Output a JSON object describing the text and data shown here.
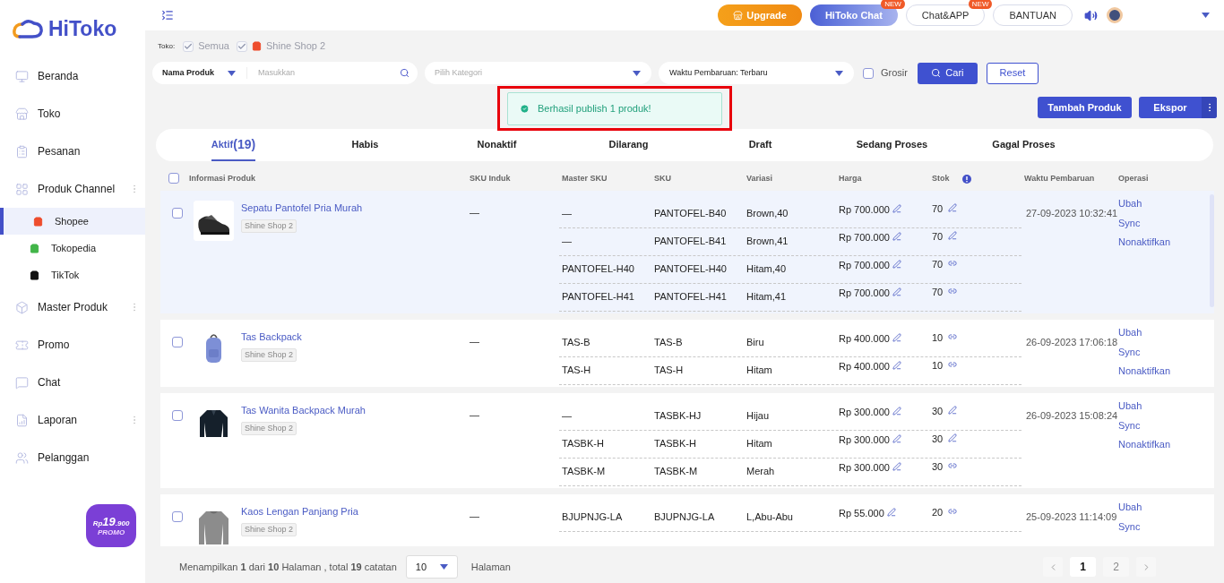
{
  "sidebar": {
    "logo": "HiToko",
    "items": [
      {
        "label": "Beranda",
        "has_menu": false
      },
      {
        "label": "Toko",
        "has_menu": false
      },
      {
        "label": "Pesanan",
        "has_menu": false
      },
      {
        "label": "Produk Channel",
        "has_menu": true,
        "children": [
          {
            "label": "Shopee",
            "selected": true
          },
          {
            "label": "Tokopedia",
            "selected": false
          },
          {
            "label": "TikTok",
            "selected": false
          }
        ]
      },
      {
        "label": "Master Produk",
        "has_menu": true
      },
      {
        "label": "Promo",
        "has_menu": false
      },
      {
        "label": "Chat",
        "has_menu": false
      },
      {
        "label": "Laporan",
        "has_menu": true
      },
      {
        "label": "Pelanggan",
        "has_menu": false
      }
    ],
    "promo": {
      "currency": "Rp",
      "amount": "19",
      "decimals": ".900",
      "label": "PROMO"
    }
  },
  "topbar": {
    "buttons": [
      {
        "label": "Upgrade",
        "kind": "upgrade"
      },
      {
        "label": "HiToko Chat",
        "kind": "chat",
        "badge": "NEW"
      },
      {
        "label": "Chat&APP",
        "kind": "outline",
        "badge": "NEW"
      },
      {
        "label": "BANTUAN",
        "kind": "outline"
      }
    ]
  },
  "filters": {
    "store_label": "Toko:",
    "stores": [
      {
        "label": "Semua",
        "kind": "all",
        "checked": true,
        "disabled": true
      },
      {
        "label": "Shine Shop 2",
        "kind": "shop",
        "checked": true,
        "disabled": true
      }
    ],
    "search_by": "Nama Produk",
    "search_placeholder": "Masukkan",
    "category_placeholder": "Pilih Kategori",
    "sort": "Waktu Pembaruan: Terbaru",
    "wholesale": {
      "label": "Grosir",
      "checked": false
    },
    "search_button": "Cari",
    "reset_button": "Reset"
  },
  "toast": {
    "message": "Berhasil publish 1 produk!",
    "highlighted": true
  },
  "actions": {
    "add": "Tambah Produk",
    "export": "Ekspor"
  },
  "tabs": [
    {
      "label": "Aktif",
      "count": "(19)",
      "selected": true
    },
    {
      "label": "Habis",
      "selected": false
    },
    {
      "label": "Nonaktif",
      "selected": false
    },
    {
      "label": "Dilarang",
      "selected": false
    },
    {
      "label": "Draft",
      "selected": false
    },
    {
      "label": "Sedang Proses",
      "selected": false
    },
    {
      "label": "Gagal Proses",
      "selected": false
    }
  ],
  "table": {
    "select_all": {
      "checked": false
    },
    "columns": [
      {
        "label": "Informasi Produk",
        "info": false
      },
      {
        "label": "SKU Induk",
        "info": false
      },
      {
        "label": "Master SKU",
        "info": false
      },
      {
        "label": "SKU",
        "info": false
      },
      {
        "label": "Variasi",
        "info": false
      },
      {
        "label": "Harga",
        "info": false
      },
      {
        "label": "Stok",
        "info": true
      },
      {
        "label": "Waktu Pembaruan",
        "info": false
      },
      {
        "label": "Operasi",
        "info": false
      }
    ],
    "products": [
      {
        "name": "Sepatu Pantofel Pria Murah",
        "store": "Shine Shop 2",
        "checked": false,
        "highlighted": true,
        "sku_induk": "—",
        "updated": "27-09-2023 10:32:41",
        "operations": [
          "Ubah",
          "Sync",
          "Nonaktifkan"
        ],
        "variants": [
          {
            "master_sku": "—",
            "sku": "PANTOFEL-B40",
            "variasi": "Brown,40",
            "harga": "Rp 700.000",
            "stok": "70",
            "stock_linked": false
          },
          {
            "master_sku": "—",
            "sku": "PANTOFEL-B41",
            "variasi": "Brown,41",
            "harga": "Rp 700.000",
            "stok": "70",
            "stock_linked": false
          },
          {
            "master_sku": "PANTOFEL-H40",
            "sku": "PANTOFEL-H40",
            "variasi": "Hitam,40",
            "harga": "Rp 700.000",
            "stok": "70",
            "stock_linked": true
          },
          {
            "master_sku": "PANTOFEL-H41",
            "sku": "PANTOFEL-H41",
            "variasi": "Hitam,41",
            "harga": "Rp 700.000",
            "stok": "70",
            "stock_linked": true
          }
        ]
      },
      {
        "name": "Tas Backpack",
        "store": "Shine Shop 2",
        "checked": false,
        "highlighted": false,
        "sku_induk": "—",
        "updated": "26-09-2023 17:06:18",
        "operations": [
          "Ubah",
          "Sync",
          "Nonaktifkan"
        ],
        "variants": [
          {
            "master_sku": "TAS-B",
            "sku": "TAS-B",
            "variasi": "Biru",
            "harga": "Rp 400.000",
            "stok": "10",
            "stock_linked": true
          },
          {
            "master_sku": "TAS-H",
            "sku": "TAS-H",
            "variasi": "Hitam",
            "harga": "Rp 400.000",
            "stok": "10",
            "stock_linked": true
          }
        ]
      },
      {
        "name": "Tas Wanita Backpack Murah",
        "store": "Shine Shop 2",
        "checked": false,
        "highlighted": false,
        "sku_induk": "—",
        "updated": "26-09-2023 15:08:24",
        "operations": [
          "Ubah",
          "Sync",
          "Nonaktifkan"
        ],
        "variants": [
          {
            "master_sku": "—",
            "sku": "TASBK-HJ",
            "variasi": "Hijau",
            "harga": "Rp 300.000",
            "stok": "30",
            "stock_linked": false
          },
          {
            "master_sku": "TASBK-H",
            "sku": "TASBK-H",
            "variasi": "Hitam",
            "harga": "Rp 300.000",
            "stok": "30",
            "stock_linked": false
          },
          {
            "master_sku": "TASBK-M",
            "sku": "TASBK-M",
            "variasi": "Merah",
            "harga": "Rp 300.000",
            "stok": "30",
            "stock_linked": true
          }
        ]
      },
      {
        "name": "Kaos Lengan Panjang Pria",
        "store": "Shine Shop 2",
        "checked": false,
        "highlighted": false,
        "sku_induk": "—",
        "updated": "25-09-2023 11:14:09",
        "operations": [
          "Ubah",
          "Sync"
        ],
        "variants": [
          {
            "master_sku": "BJUPNJG-LA",
            "sku": "BJUPNJG-LA",
            "variasi": "L,Abu-Abu",
            "harga": "Rp 55.000",
            "stok": "20",
            "stock_linked": true
          }
        ]
      }
    ]
  },
  "footer": {
    "summary": "Menampilkan **1** dari **10** Halaman , total **19** catatan",
    "page_size": "10",
    "page_size_suffix": "Halaman",
    "pages": [
      {
        "label": "1",
        "selected": true
      },
      {
        "label": "2",
        "selected": false
      }
    ]
  }
}
